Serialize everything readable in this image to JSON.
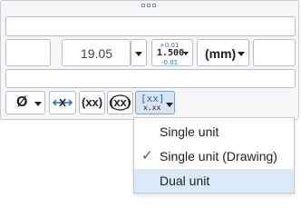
{
  "row2": {
    "value": "19.05",
    "tol_plus": "+0.01",
    "tol_nominal": "1.500",
    "tol_minus": "-0.01",
    "unit": "(mm)"
  },
  "buttons": {
    "diameter_symbol": "Ø",
    "basic_dim": "(xx)",
    "reference_dim": "(xx)",
    "dual_top": "[xx]",
    "dual_bottom": "x.xx"
  },
  "menu": {
    "items": [
      {
        "label": "Single unit",
        "checked": false,
        "highlighted": false
      },
      {
        "label": "Single unit (Drawing)",
        "checked": true,
        "highlighted": false
      },
      {
        "label": "Dual unit",
        "checked": false,
        "highlighted": true
      }
    ],
    "check_glyph": "✓"
  },
  "colors": {
    "accent": "#2b6cb0",
    "highlight": "#d9e9f8",
    "active_button": "#d9e4f2"
  }
}
